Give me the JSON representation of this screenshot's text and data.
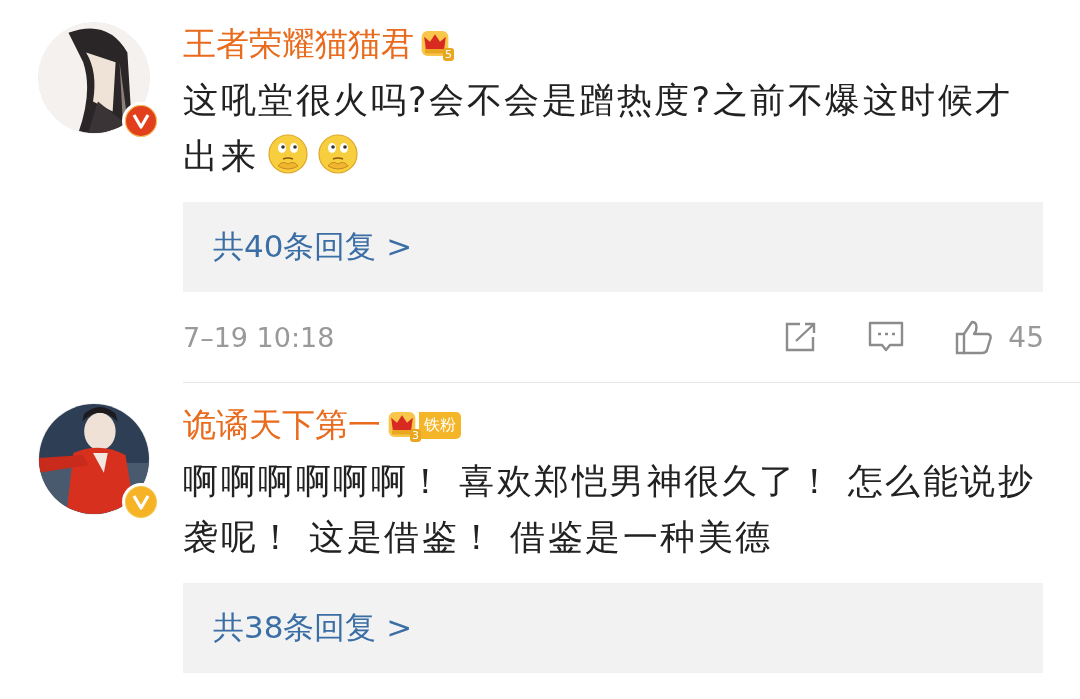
{
  "comments": [
    {
      "user": {
        "name": "王者荣耀猫猫君",
        "badge_level": "5",
        "verified": {
          "color": "#e2401c"
        }
      },
      "text": "这吼堂很火吗?会不会是蹭热度?之前不爆这时候才出来",
      "emojis": [
        {
          "kind": "thinking"
        },
        {
          "kind": "thinking"
        }
      ],
      "replies": "共40条回复 >",
      "meta": {
        "time": "7–19 10:18",
        "likes": "45"
      }
    },
    {
      "user": {
        "name": "诡谲天下第一",
        "badge_level": "3",
        "fan_tag": "铁粉",
        "verified": {
          "color": "#f5b325"
        }
      },
      "text": "啊啊啊啊啊啊！ 喜欢郑恺男神很久了！ 怎么能说抄袭呢！ 这是借鉴！ 借鉴是一种美德",
      "replies": "共38条回复 >"
    }
  ]
}
